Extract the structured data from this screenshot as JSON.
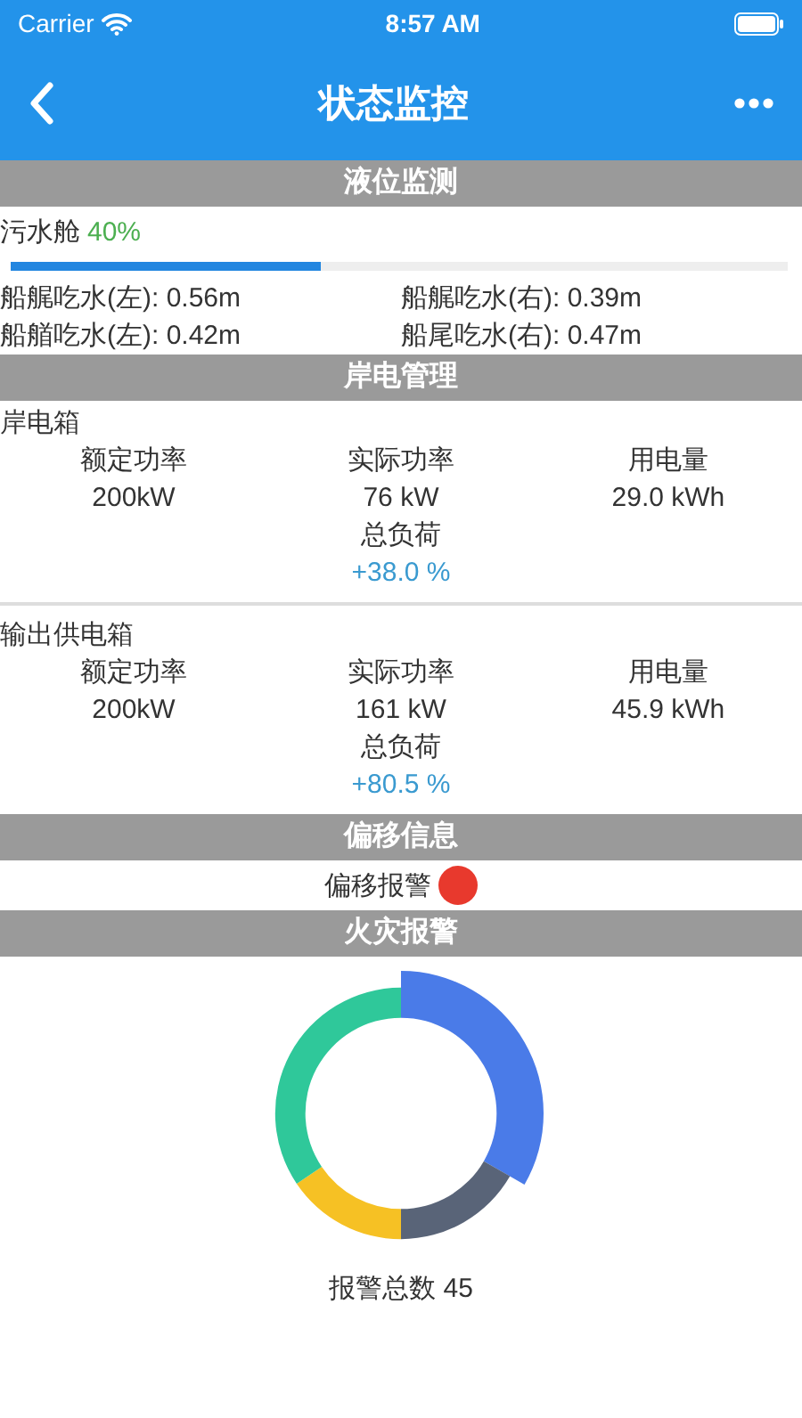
{
  "status_bar": {
    "carrier": "Carrier",
    "time": "8:57 AM"
  },
  "nav": {
    "title": "状态监控"
  },
  "level_section": {
    "header": "液位监测",
    "tank": {
      "label": "污水舱",
      "value": "40%",
      "level": 0.4
    },
    "drafts": [
      "船艉吃水(左): 0.56m",
      "船艉吃水(右): 0.39m",
      "船艏吃水(左): 0.42m",
      "船尾吃水(右): 0.47m"
    ]
  },
  "shore_power": {
    "header": "岸电管理",
    "boxes": [
      {
        "title": "岸电箱",
        "metrics": [
          {
            "label": "额定功率",
            "value": "200kW"
          },
          {
            "label": "实际功率",
            "value": "76 kW"
          },
          {
            "label": "用电量",
            "value": "29.0 kWh"
          }
        ],
        "load_label": "总负荷",
        "load_value": "+38.0 %"
      },
      {
        "title": "输出供电箱",
        "metrics": [
          {
            "label": "额定功率",
            "value": "200kW"
          },
          {
            "label": "实际功率",
            "value": "161 kW"
          },
          {
            "label": "用电量",
            "value": "45.9 kWh"
          }
        ],
        "load_label": "总负荷",
        "load_value": "+80.5 %"
      }
    ]
  },
  "offset": {
    "header": "偏移信息",
    "alarm_label": "偏移报警",
    "alarm": true
  },
  "fire": {
    "header": "火灾报警",
    "total": "报警总数 45"
  }
}
